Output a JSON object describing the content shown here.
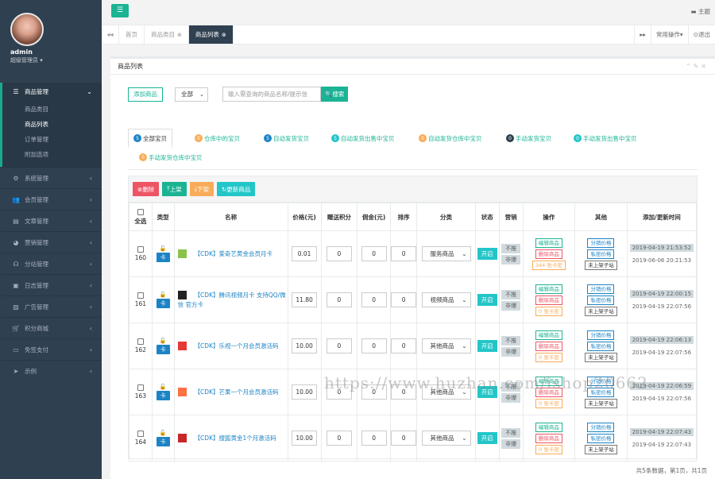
{
  "user": {
    "name": "admin",
    "role": "超级管理员 ▾"
  },
  "sidebar": {
    "active": {
      "label": "商品管理",
      "sub": [
        "商品类目",
        "商品列表",
        "订单管理",
        "附加选项"
      ],
      "current": 1
    },
    "groups": [
      {
        "label": "系统管理",
        "icon": "gear-icon",
        "glyph": "⚙"
      },
      {
        "label": "会员管理",
        "icon": "users-icon",
        "glyph": "👥"
      },
      {
        "label": "文章管理",
        "icon": "doc-icon",
        "glyph": "▤"
      },
      {
        "label": "营销管理",
        "icon": "pie-icon",
        "glyph": "◕"
      },
      {
        "label": "分站管理",
        "icon": "sitemap-icon",
        "glyph": "☊"
      },
      {
        "label": "日志管理",
        "icon": "log-icon",
        "glyph": "▣"
      },
      {
        "label": "广告管理",
        "icon": "image-icon",
        "glyph": "▨"
      },
      {
        "label": "积分商城",
        "icon": "cart-icon",
        "glyph": "🛒"
      },
      {
        "label": "免签支付",
        "icon": "card-icon",
        "glyph": "▭"
      },
      {
        "label": "示例",
        "icon": "send-icon",
        "glyph": "➤"
      }
    ]
  },
  "topbar": {
    "theme": "主题"
  },
  "tabs": {
    "items": [
      "首页",
      "商品类目",
      "商品列表"
    ],
    "right": [
      "常用操作▾",
      "⊙退出"
    ]
  },
  "panel": {
    "title": "商品列表"
  },
  "toolbar": {
    "add": "添加商品",
    "select": "全部",
    "search_placeholder": "输入需查询的商品名称/提示信",
    "search_btn": "搜索"
  },
  "filters": [
    {
      "n": "5",
      "label": "全部宝贝",
      "color": "n-blue"
    },
    {
      "n": "0",
      "label": "仓库中的宝贝",
      "color": "n-orange"
    },
    {
      "n": "5",
      "label": "自动发货宝贝",
      "color": "n-blue"
    },
    {
      "n": "5",
      "label": "自动发货出售中宝贝",
      "color": "n-cyan"
    },
    {
      "n": "0",
      "label": "自动发货仓库中宝贝",
      "color": "n-orange"
    },
    {
      "n": "0",
      "label": "手动发货宝贝",
      "color": "n-dark"
    },
    {
      "n": "0",
      "label": "手动发货出售中宝贝",
      "color": "n-cyan"
    },
    {
      "n": "0",
      "label": "手动发货仓库中宝贝",
      "color": "n-orange"
    }
  ],
  "actions": [
    "删除",
    "上架",
    "下架",
    "更新商品"
  ],
  "columns": [
    "全选",
    "类型",
    "名称",
    "价格(元)",
    "赠送积分",
    "佣金(元)",
    "排序",
    "分类",
    "状态",
    "营销",
    "操作",
    "其他",
    "添加/更新时间"
  ],
  "rows": [
    {
      "id": "160",
      "name": "【CDK】爱奇艺黄金会员月卡",
      "price": "0.01",
      "points": "0",
      "comm": "0",
      "sort": "0",
      "cat": "服务商品",
      "stock": "344 张卡密",
      "t1": "2019-04-19 21:53:52",
      "t2": "2019-06-06 20:21:53",
      "pic": "#8bc34a"
    },
    {
      "id": "161",
      "name": "【CDK】腾讯视频月卡 支持QQ/微信 官方卡",
      "price": "11.80",
      "points": "0",
      "comm": "0",
      "sort": "0",
      "cat": "视频商品",
      "stock": "0 张卡密",
      "t1": "2019-04-19 22:00:15",
      "t2": "2019-04-19 22:07:56",
      "pic": "#222"
    },
    {
      "id": "162",
      "name": "【CDK】乐视一个月会员激活码",
      "price": "10.00",
      "points": "0",
      "comm": "0",
      "sort": "0",
      "cat": "其他商品",
      "stock": "0 张卡密",
      "t1": "2019-04-19 22:06:13",
      "t2": "2019-04-19 22:07:56",
      "pic": "#e53935"
    },
    {
      "id": "163",
      "name": "【CDK】芒果一个月会员激活码",
      "price": "10.00",
      "points": "0",
      "comm": "0",
      "sort": "0",
      "cat": "其他商品",
      "stock": "0 张卡密",
      "t1": "2019-04-19 22:06:59",
      "t2": "2019-04-19 22:07:56",
      "pic": "#ff7043"
    },
    {
      "id": "164",
      "name": "【CDK】搜狐黄金1个月激活码",
      "price": "10.00",
      "points": "0",
      "comm": "0",
      "sort": "0",
      "cat": "其他商品",
      "stock": "0 张卡密",
      "t1": "2019-04-19 22:07:43",
      "t2": "2019-04-19 22:07:43",
      "pic": "#c62828"
    }
  ],
  "row_labels": {
    "type": "卡",
    "status": "开启",
    "mk1": "不推",
    "mk2": "非爆",
    "edit": "编辑商品",
    "del": "删除商品",
    "link": "分销价格",
    "secret": "私密价格",
    "sub": "未上架子站"
  },
  "footer": "共5条数据，第1页，共1页",
  "watermark": "https://www.huzhan.com/ishop20662"
}
